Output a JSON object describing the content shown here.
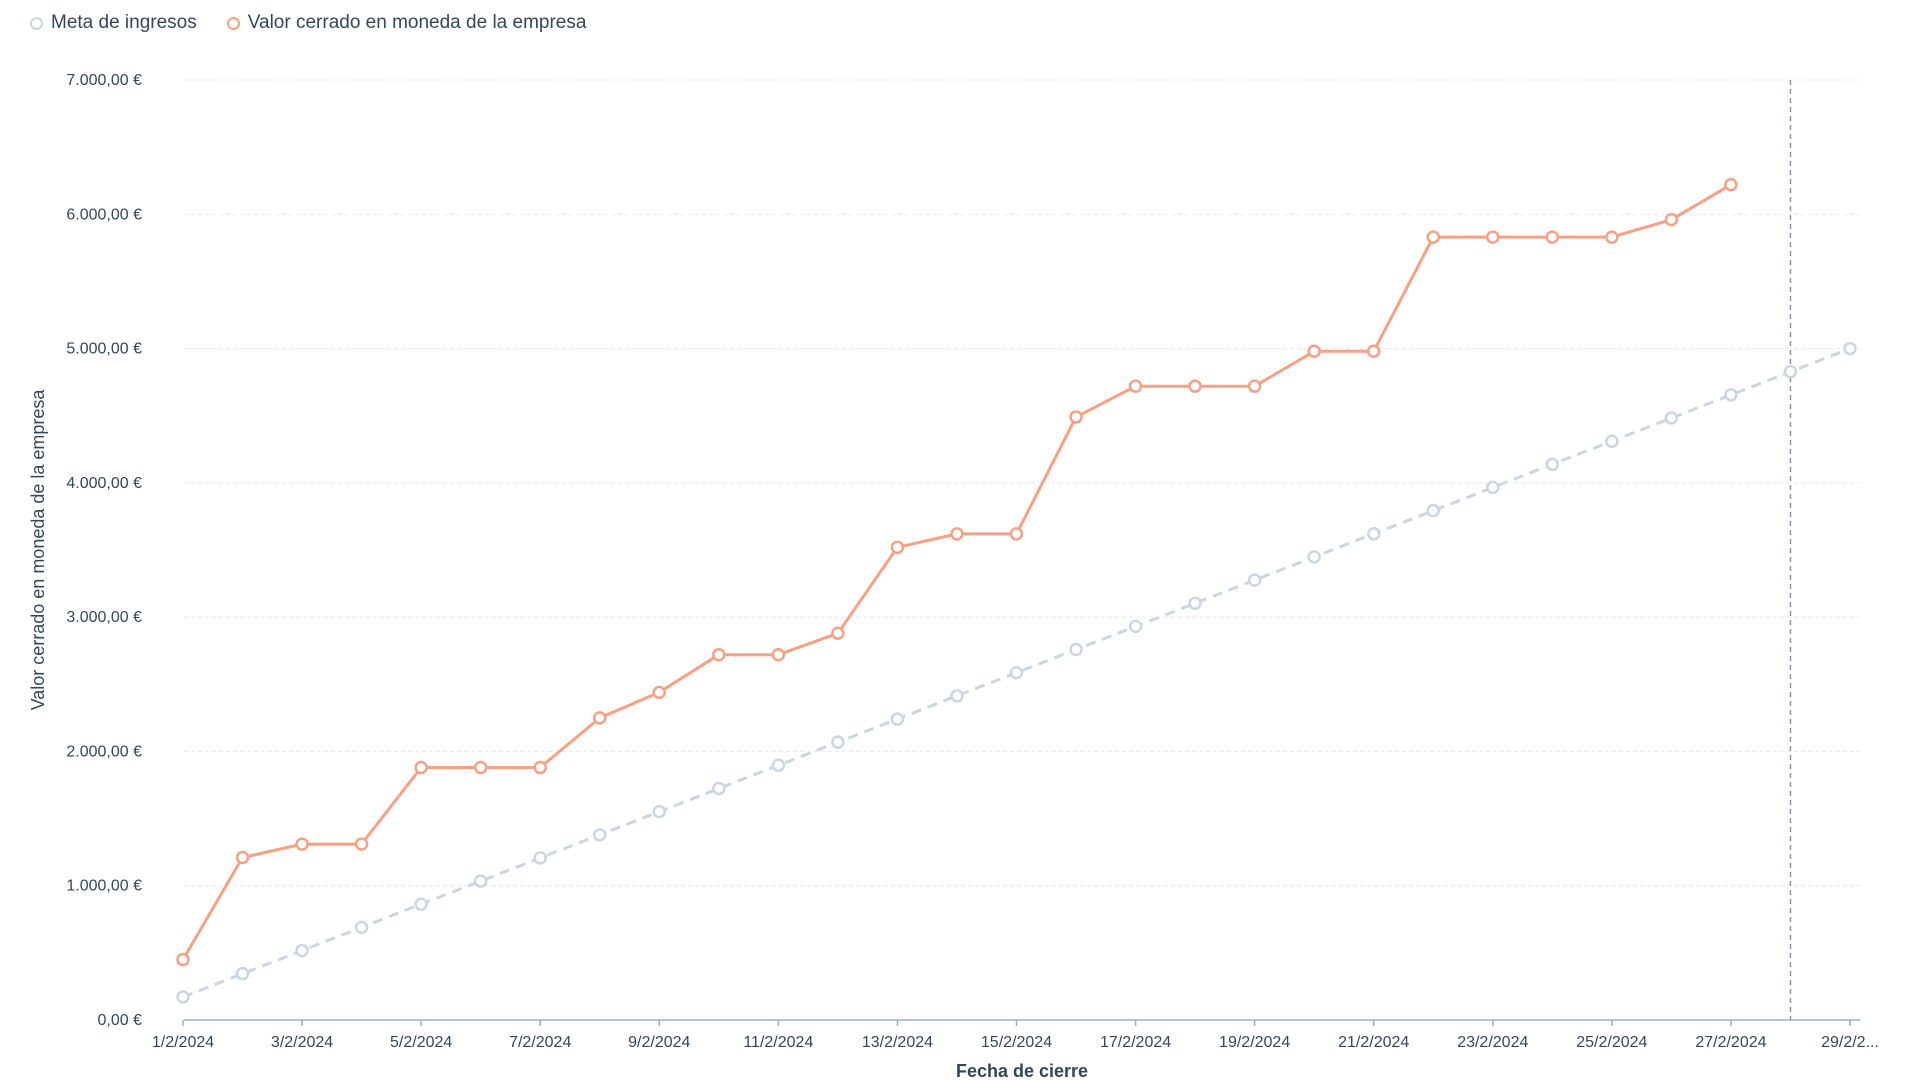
{
  "legend": {
    "items": [
      {
        "label": "Meta de ingresos",
        "color": "#cbd6e2"
      },
      {
        "label": "Valor cerrado en moneda de la empresa",
        "color": "#f8a083"
      }
    ]
  },
  "chart_data": {
    "type": "line",
    "xlabel": "Fecha de cierre",
    "ylabel": "Valor cerrado en moneda de la empresa",
    "ylim": [
      0,
      7000
    ],
    "y_ticks": [
      "0,00 €",
      "1.000,00 €",
      "2.000,00 €",
      "3.000,00 €",
      "4.000,00 €",
      "5.000,00 €",
      "6.000,00 €",
      "7.000,00 €"
    ],
    "y_tick_values": [
      0,
      1000,
      2000,
      3000,
      4000,
      5000,
      6000,
      7000
    ],
    "grid": true,
    "legend_position": "top-left",
    "x": [
      "1/2/2024",
      "2/2/2024",
      "3/2/2024",
      "4/2/2024",
      "5/2/2024",
      "6/2/2024",
      "7/2/2024",
      "8/2/2024",
      "9/2/2024",
      "10/2/2024",
      "11/2/2024",
      "12/2/2024",
      "13/2/2024",
      "14/2/2024",
      "15/2/2024",
      "16/2/2024",
      "17/2/2024",
      "18/2/2024",
      "19/2/2024",
      "20/2/2024",
      "21/2/2024",
      "22/2/2024",
      "23/2/2024",
      "24/2/2024",
      "25/2/2024",
      "26/2/2024",
      "27/2/2024",
      "28/2/2024",
      "29/2/2024"
    ],
    "x_tick_labels": [
      "1/2/2024",
      "3/2/2024",
      "5/2/2024",
      "7/2/2024",
      "9/2/2024",
      "11/2/2024",
      "13/2/2024",
      "15/2/2024",
      "17/2/2024",
      "19/2/2024",
      "21/2/2024",
      "23/2/2024",
      "25/2/2024",
      "27/2/2024",
      "29/2/2..."
    ],
    "x_tick_indices": [
      0,
      2,
      4,
      6,
      8,
      10,
      12,
      14,
      16,
      18,
      20,
      22,
      24,
      26,
      28
    ],
    "today_marker": "28/2/2024",
    "series": [
      {
        "name": "Meta de ingresos",
        "color": "#cbd6e2",
        "dashed": true,
        "values": [
          172,
          345,
          517,
          690,
          862,
          1034,
          1207,
          1379,
          1552,
          1724,
          1897,
          2069,
          2241,
          2414,
          2586,
          2759,
          2931,
          3103,
          3276,
          3448,
          3621,
          3793,
          3966,
          4138,
          4310,
          4483,
          4655,
          4828,
          5000
        ]
      },
      {
        "name": "Valor cerrado en moneda de la empresa",
        "color": "#f8a083",
        "dashed": false,
        "values": [
          450,
          1210,
          1310,
          1310,
          1880,
          1880,
          1880,
          2250,
          2440,
          2720,
          2720,
          2880,
          3520,
          3620,
          3620,
          4490,
          4720,
          4720,
          4720,
          4980,
          4980,
          5830,
          5830,
          5830,
          5830,
          5960,
          6220
        ]
      }
    ]
  }
}
